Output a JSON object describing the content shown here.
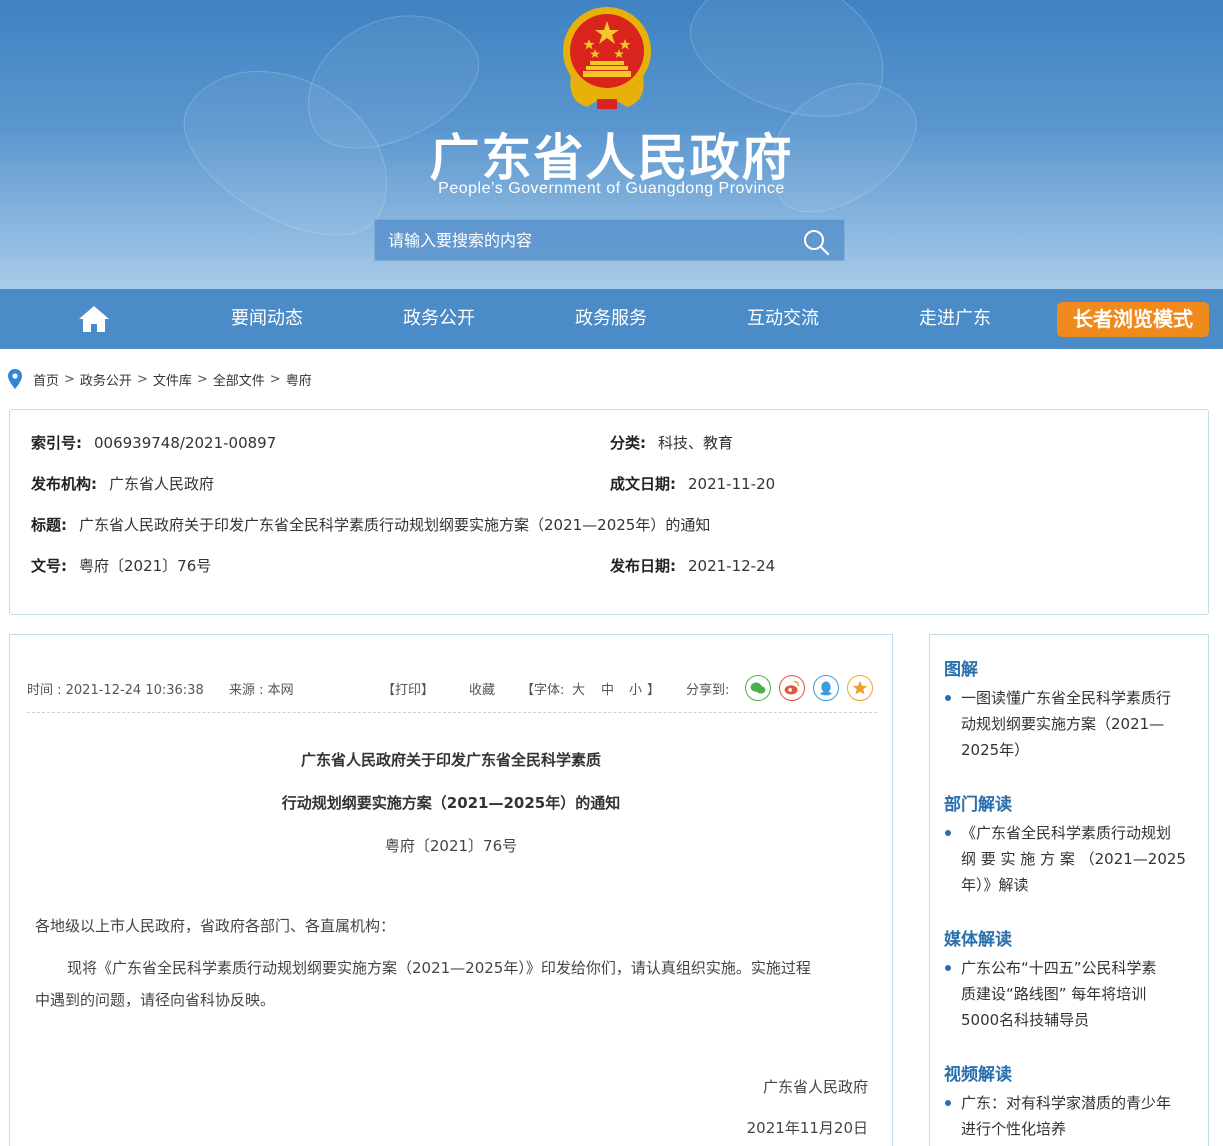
{
  "header": {
    "title": "广东省人民政府",
    "subtitle": "People’s Government of Guangdong Province",
    "search_placeholder": "请输入要搜索的内容"
  },
  "nav": {
    "items": [
      "要闻动态",
      "政务公开",
      "政务服务",
      "互动交流",
      "走进广东"
    ],
    "elder_mode": "长者浏览模式"
  },
  "breadcrumb": [
    "首页",
    "政务公开",
    "文件库",
    "全部文件",
    "粤府"
  ],
  "meta": {
    "index_label": "索引号:",
    "index_value": "006939748/2021-00897",
    "category_label": "分类:",
    "category_value": "科技、教育",
    "publisher_label": "发布机构:",
    "publisher_value": "广东省人民政府",
    "created_label": "成文日期:",
    "created_value": "2021-11-20",
    "title_label": "标题:",
    "title_value": "广东省人民政府关于印发广东省全民科学素质行动规划纲要实施方案（2021—2025年）的通知",
    "docno_label": "文号:",
    "docno_value": "粤府〔2021〕76号",
    "published_label": "发布日期:",
    "published_value": "2021-12-24"
  },
  "toolbar": {
    "time": "时间 : 2021-12-24 10:36:38",
    "source": "来源 : 本网",
    "print": "【打印】",
    "favorite": "收藏",
    "font_open": "【字体:",
    "font_large": "大",
    "font_medium": "中",
    "font_small": "小",
    "font_close": "】",
    "share": "分享到:"
  },
  "article": {
    "title_line1": "广东省人民政府关于印发广东省全民科学素质",
    "title_line2": "行动规划纲要实施方案（2021—2025年）的通知",
    "doc_no": "粤府〔2021〕76号",
    "salutation": "各地级以上市人民政府，省政府各部门、各直属机构：",
    "body_line1": "现将《广东省全民科学素质行动规划纲要实施方案（2021—2025年）》印发给你们，请认真组织实施。实施过程",
    "body_line2": "中遇到的问题，请径向省科协反映。",
    "signer": "广东省人民政府",
    "date": "2021年11月20日"
  },
  "sidebar": {
    "sections": [
      {
        "heading": "图解",
        "lines": [
          "一图读懂广东省全民科学素质行",
          "动规划纲要实施方案（2021—",
          "2025年）"
        ]
      },
      {
        "heading": "部门解读",
        "lines": [
          "《广东省全民科学素质行动规划",
          "纲 要 实 施 方 案 （2021—2025",
          "年）》解读"
        ]
      },
      {
        "heading": "媒体解读",
        "lines": [
          "广东公布“十四五”公民科学素",
          "质建设“路线图” 每年将培训",
          "5000名科技辅导员"
        ]
      },
      {
        "heading": "视频解读",
        "lines": [
          "广东：对有科学家潜质的青少年",
          "进行个性化培养"
        ]
      }
    ]
  },
  "colors": {
    "nav_bg": "#4b8bc8",
    "elder_btn": "#f08a1c",
    "heading_blue": "#2a6fad"
  }
}
